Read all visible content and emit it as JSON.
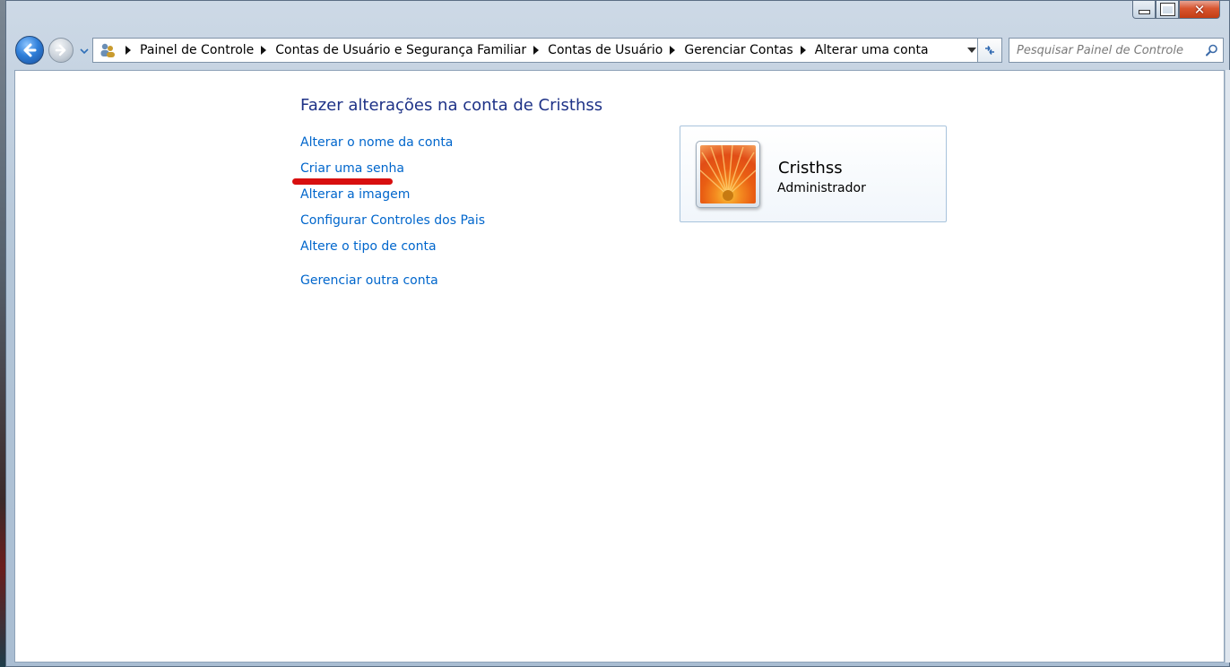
{
  "window": {
    "caption_buttons": [
      "minimize-icon",
      "maximize-icon",
      "close-icon"
    ]
  },
  "navigation": {
    "back_icon": "back-arrow-icon",
    "forward_icon": "forward-arrow-icon"
  },
  "address_bar": {
    "breadcrumbs": [
      "Painel de Controle",
      "Contas de Usuário e Segurança Familiar",
      "Contas de Usuário",
      "Gerenciar Contas",
      "Alterar uma conta"
    ]
  },
  "search": {
    "placeholder": "Pesquisar Painel de Controle"
  },
  "main": {
    "title": "Fazer alterações na conta de Cristhss",
    "tasks": [
      "Alterar o nome da conta",
      "Criar uma senha",
      "Alterar a imagem",
      "Configurar Controles dos Pais",
      "Altere o tipo de conta"
    ],
    "other_task": "Gerenciar outra conta"
  },
  "account": {
    "name": "Cristhss",
    "role": "Administrador"
  },
  "colors": {
    "link": "#0066cc",
    "title": "#1e3287",
    "highlight": "#d80f0f"
  }
}
